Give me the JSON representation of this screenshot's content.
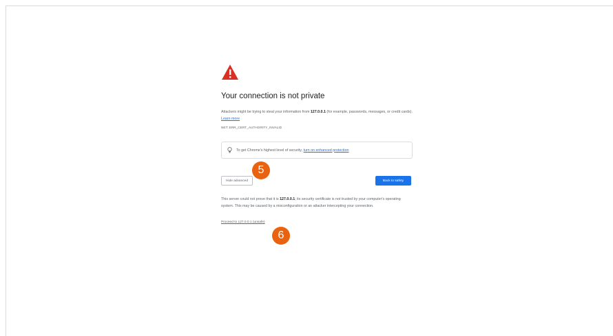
{
  "page": {
    "title": "Your connection is not private",
    "desc_prefix": "Attackers might be trying to steal your information from ",
    "host": "127.0.0.1",
    "desc_suffix": " (for example, passwords, messages, or credit cards). ",
    "learn_more": "Learn more",
    "error_code": "NET::ERR_CERT_AUTHORITY_INVALID",
    "enhanced_prefix": "To get Chrome's highest level of security, ",
    "enhanced_link": "turn on enhanced protection",
    "hide_advanced": "Hide advanced",
    "back_to_safety": "Back to safety",
    "details_prefix": "This server could not prove that it is ",
    "details_host": "127.0.0.1",
    "details_suffix": "; its security certificate is not trusted by your computer's operating system. This may be caused by a misconfiguration or an attacker intercepting your connection.",
    "proceed_link": "Proceed to 127.0.0.1 (unsafe)"
  },
  "callouts": {
    "first": "5",
    "second": "6"
  },
  "colors": {
    "warning_red": "#d93025",
    "accent_blue": "#1a73e8",
    "callout_orange": "#e8620f"
  },
  "icons": {
    "warning": "warning-triangle-icon",
    "bulb": "lightbulb-icon"
  }
}
